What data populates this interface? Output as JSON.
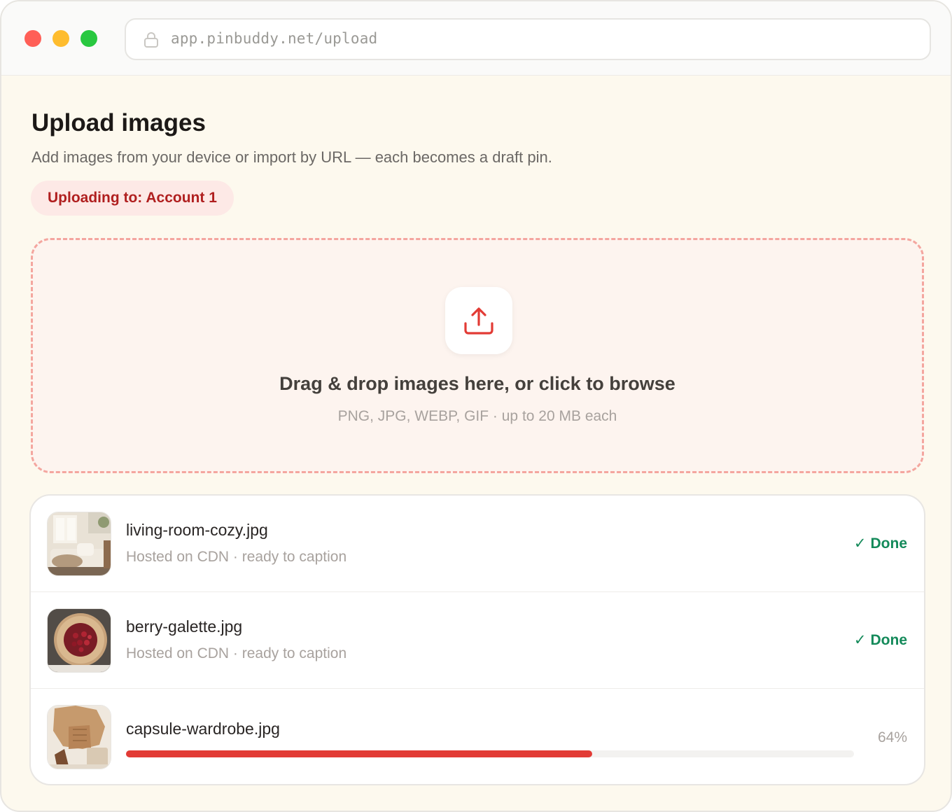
{
  "browser": {
    "url": "app.pinbuddy.net/upload",
    "window_controls": [
      "close",
      "minimize",
      "maximize"
    ]
  },
  "page": {
    "title": "Upload images",
    "subtitle": "Add images from your device or import by URL — each becomes a draft pin.",
    "account_pill": "Uploading to: Account 1"
  },
  "dropzone": {
    "icon": "upload-icon",
    "title": "Drag & drop images here, or click to browse",
    "hint": "PNG, JPG, WEBP, GIF · up to 20 MB each"
  },
  "files": [
    {
      "name": "living-room-cozy.jpg",
      "meta": "Hosted on CDN · ready to caption",
      "status": "Done",
      "thumbnail": "living-room-photo"
    },
    {
      "name": "berry-galette.jpg",
      "meta": "Hosted on CDN · ready to caption",
      "status": "Done",
      "thumbnail": "berry-galette-photo"
    },
    {
      "name": "capsule-wardrobe.jpg",
      "progress_label": "64%",
      "progress": 0.64,
      "thumbnail": "capsule-wardrobe-photo"
    }
  ],
  "colors": {
    "accent": "#e23b35",
    "success": "#148a5a",
    "pill_bg": "#fde9e6",
    "pill_text": "#b01f1f",
    "page_bg": "#fdf9ee"
  }
}
